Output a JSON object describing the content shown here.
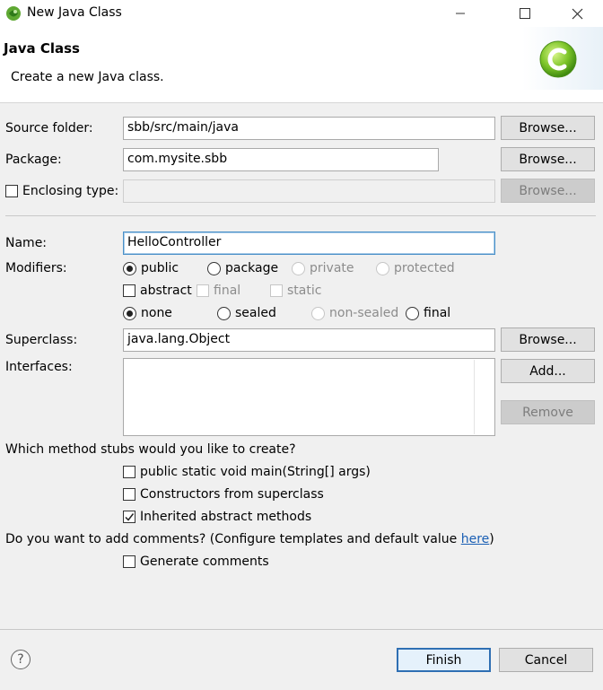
{
  "window": {
    "title": "New Java Class"
  },
  "header": {
    "title": "Java Class",
    "description": "Create a new Java class."
  },
  "source_folder": {
    "label": "Source folder:",
    "value": "sbb/src/main/java",
    "browse": "Browse..."
  },
  "package": {
    "label": "Package:",
    "value": "com.mysite.sbb",
    "browse": "Browse..."
  },
  "enclosing": {
    "label": "Enclosing type:",
    "value": "",
    "browse": "Browse..."
  },
  "name": {
    "label": "Name:",
    "value": "HelloController"
  },
  "modifiers": {
    "label": "Modifiers:",
    "access": [
      "public",
      "package",
      "private",
      "protected"
    ],
    "flags": [
      "abstract",
      "final",
      "static"
    ],
    "sealing": [
      "none",
      "sealed",
      "non-sealed",
      "final"
    ]
  },
  "superclass": {
    "label": "Superclass:",
    "value": "java.lang.Object",
    "browse": "Browse..."
  },
  "interfaces": {
    "label": "Interfaces:",
    "add": "Add...",
    "remove": "Remove"
  },
  "stubs": {
    "question": "Which method stubs would you like to create?",
    "main": "public static void main(String[] args)",
    "constructors": "Constructors from superclass",
    "inherited": "Inherited abstract methods"
  },
  "comments": {
    "question_pre": "Do you want to add comments? (Configure templates and default value ",
    "link": "here",
    "question_post": ")",
    "generate": "Generate comments"
  },
  "footer": {
    "help": "?",
    "finish": "Finish",
    "cancel": "Cancel"
  }
}
